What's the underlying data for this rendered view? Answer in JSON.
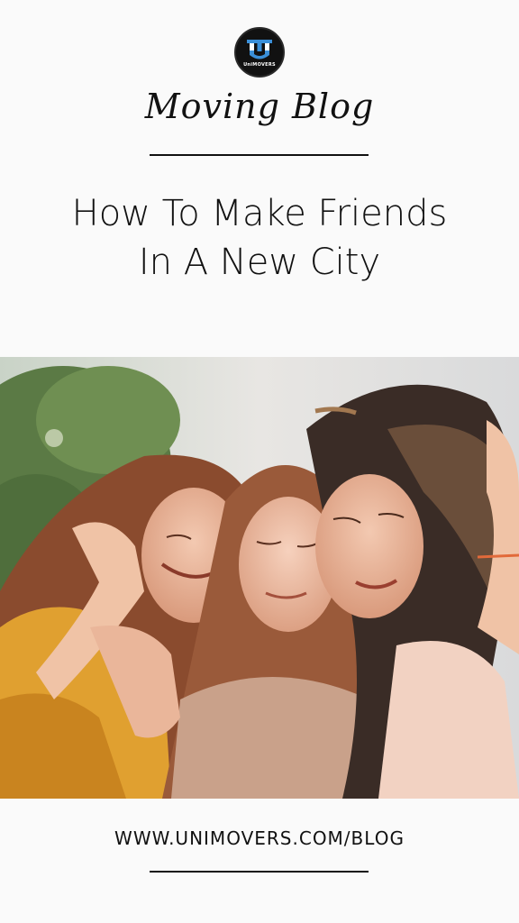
{
  "brand": {
    "logo_wordmark": "UniMOVERS",
    "logo_icon": "unimovers-u-logo"
  },
  "header": {
    "script_title": "Moving Blog",
    "headline_line1": "How To Make Friends",
    "headline_line2": "In A New City"
  },
  "photo": {
    "icon": "three-friends-hugging-photo"
  },
  "footer": {
    "url": "WWW.UNIMOVERS.COM/BLOG"
  },
  "colors": {
    "background": "#fafafa",
    "text": "#111111",
    "logo_bg": "#111111",
    "logo_accent": "#3a8fd8"
  }
}
